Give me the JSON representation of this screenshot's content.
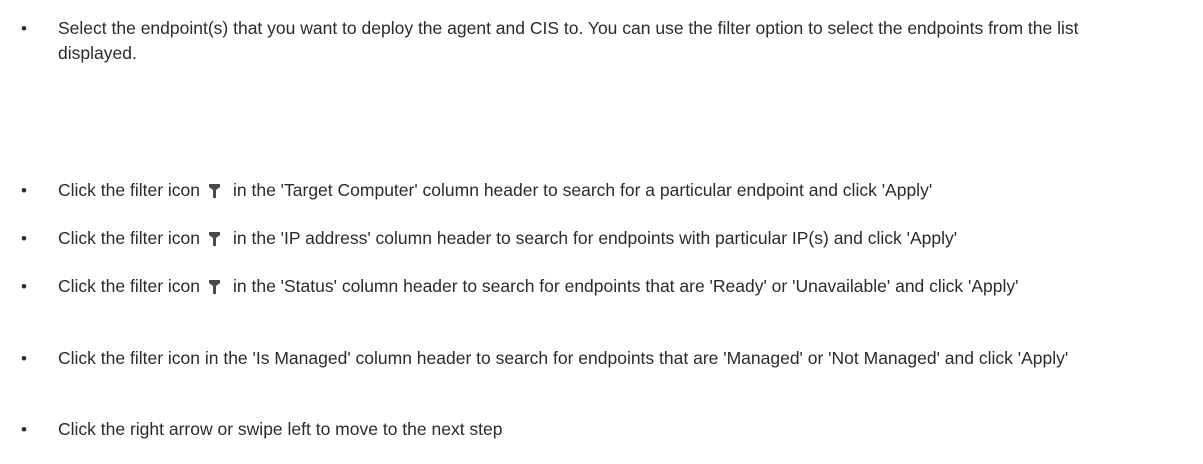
{
  "content": {
    "intro": {
      "text": "Select the endpoint(s) that you want to deploy the agent and CIS to. You can use the filter option to select the endpoints from the list displayed."
    },
    "steps": [
      {
        "before": "Click the filter icon",
        "after": "in the 'Target Computer' column header to search for a particular endpoint and click 'Apply'",
        "has_icon": true
      },
      {
        "before": "Click the filter icon",
        "after": "in the 'IP address' column header to search for endpoints with particular IP(s) and click 'Apply'",
        "has_icon": true
      },
      {
        "before": "Click the filter icon",
        "after": "in the 'Status' column header to search for endpoints that are 'Ready' or 'Unavailable' and click 'Apply'",
        "has_icon": true
      },
      {
        "text": "Click the filter icon in the 'Is Managed' column header to search for endpoints that are 'Managed' or 'Not Managed' and click 'Apply'",
        "has_icon": false
      },
      {
        "text": "Click the right arrow or swipe left to move to the next step",
        "has_icon": false
      }
    ],
    "bullet_char": "•",
    "icon_name": "filter-icon"
  }
}
